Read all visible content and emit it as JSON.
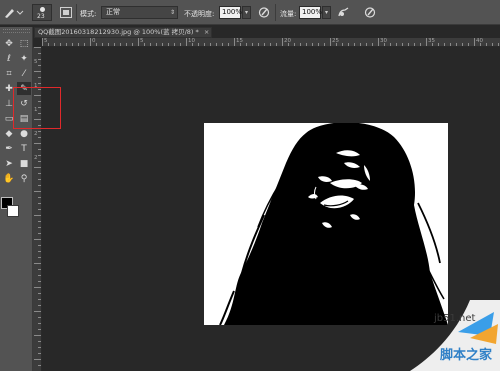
{
  "options_bar": {
    "brush_size": "23",
    "mode_label": "模式:",
    "mode_value": "正常",
    "opacity_label": "不透明度:",
    "opacity_value": "100%",
    "flow_label": "流量:",
    "flow_value": "100%"
  },
  "document": {
    "tab_label": "QQ截图20160318212930.jpg @ 100%(蓝 拷贝/8) *",
    "close_label": "×"
  },
  "ruler": {
    "horizontal": [
      "5",
      "0",
      "5",
      "10",
      "15",
      "20",
      "25",
      "30",
      "35",
      "40"
    ],
    "vertical": [
      "5",
      "1",
      "1",
      "2",
      "2"
    ]
  },
  "toolbar": {
    "tools": [
      "move-tool-icon",
      "marquee-tool-icon",
      "lasso-tool-icon",
      "magic-wand-icon",
      "crop-tool-icon",
      "eyedropper-tool-icon",
      "healing-brush-icon",
      "brush-tool-icon",
      "clone-stamp-icon",
      "history-brush-icon",
      "eraser-tool-icon",
      "gradient-tool-icon",
      "blur-tool-icon",
      "dodge-tool-icon",
      "pen-tool-icon",
      "type-tool-icon",
      "path-selection-icon",
      "rectangle-tool-icon",
      "hand-tool-icon",
      "zoom-tool-icon"
    ],
    "highlight_color": "#e0292b"
  },
  "colors": {
    "foreground": "#000000",
    "background": "#ffffff"
  },
  "watermark": {
    "site": "jb51.net",
    "name": "脚本之家"
  }
}
